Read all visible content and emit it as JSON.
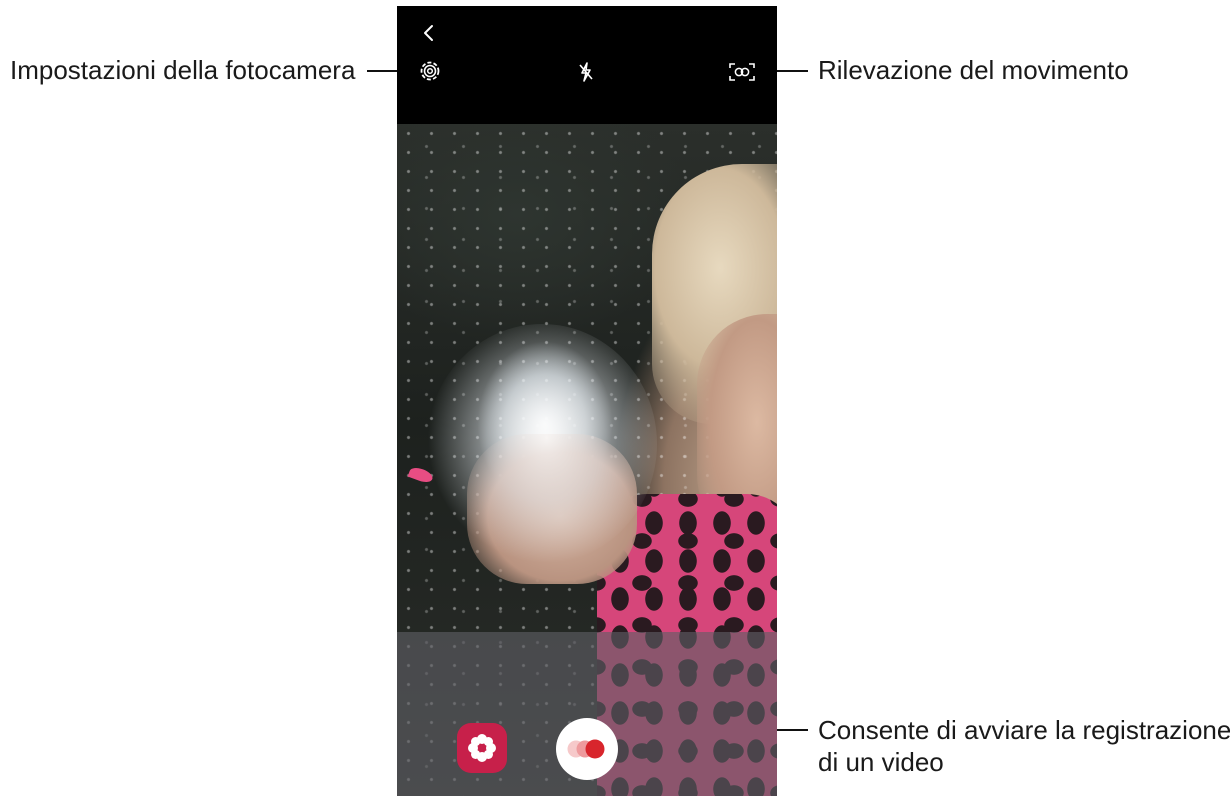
{
  "camera": {
    "icons": {
      "back": "chevron-left-icon",
      "settings": "gear-icon",
      "flash": "flash-off-icon",
      "motion_detection": "motion-detection-icon",
      "bixby_vision": "flower-icon",
      "record": "super-slow-mo-record-icon"
    },
    "colors": {
      "bixby_button": "#c7204a",
      "record_dot_main": "#d8252c",
      "record_dot_faded": "#f2b8ba"
    }
  },
  "callouts": {
    "settings": "Impostazioni della fotocamera",
    "motion_detection": "Rilevazione del movimento",
    "record_line1": "Consente di avviare la registrazione",
    "record_line2": "di un video"
  }
}
